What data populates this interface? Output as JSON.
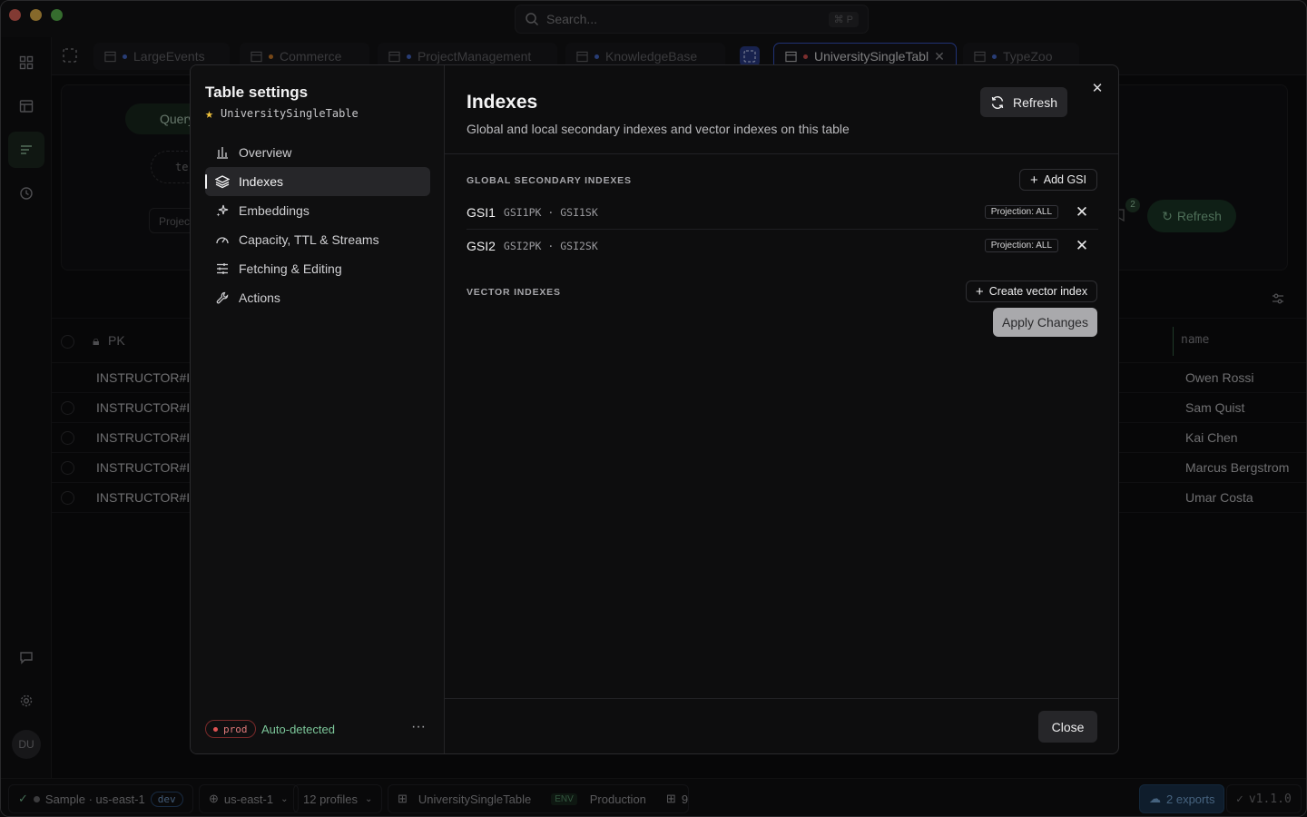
{
  "titlebar": {
    "search_placeholder": "Search...",
    "search_shortcut": "⌘ P"
  },
  "tabs": [
    {
      "label": "LargeEvents",
      "dot": "#4a6fd6"
    },
    {
      "label": "Commerce",
      "dot": "#d9822b"
    },
    {
      "label": "ProjectManagement",
      "dot": "#4a6fd6"
    },
    {
      "label": "KnowledgeBase",
      "dot": "#4a6fd6"
    },
    {
      "label": "UniversitySingleTabl",
      "dot": "#e05454"
    },
    {
      "label": "TypeZoo",
      "dot": "#4a6fd6"
    }
  ],
  "background": {
    "query_label": "Query",
    "filter_text": "te",
    "project_text": "Project",
    "badge_count": "2",
    "refresh_label": "Refresh",
    "pk_header": "PK",
    "name_header": "name",
    "rows": [
      {
        "pk": "INSTRUCTOR#IC",
        "name": "Owen Rossi"
      },
      {
        "pk": "INSTRUCTOR#IC",
        "name": "Sam Quist"
      },
      {
        "pk": "INSTRUCTOR#IC",
        "name": "Kai Chen"
      },
      {
        "pk": "INSTRUCTOR#IC",
        "name": "Marcus Bergstrom"
      },
      {
        "pk": "INSTRUCTOR#IC",
        "name": "Umar Costa"
      }
    ]
  },
  "rail": {
    "avatar_initials": "DU"
  },
  "modal": {
    "side": {
      "title": "Table settings",
      "table_name": "UniversitySingleTable",
      "nav": [
        {
          "label": "Overview",
          "icon": "bar-chart-icon"
        },
        {
          "label": "Indexes",
          "icon": "layers-icon"
        },
        {
          "label": "Embeddings",
          "icon": "sparkle-icon"
        },
        {
          "label": "Capacity, TTL & Streams",
          "icon": "gauge-icon"
        },
        {
          "label": "Fetching & Editing",
          "icon": "sliders-icon"
        },
        {
          "label": "Actions",
          "icon": "wrench-icon"
        }
      ],
      "env_badge": "prod",
      "auto_detected": "Auto-detected",
      "more": "···"
    },
    "main": {
      "title": "Indexes",
      "subtitle": "Global and local secondary indexes and vector indexes on this table",
      "refresh_label": "Refresh",
      "gsi_section_title": "GLOBAL SECONDARY INDEXES",
      "add_gsi_label": "Add GSI",
      "gsis": [
        {
          "name": "GSI1",
          "keys": "GSI1PK · GSI1SK",
          "projection": "Projection: ALL"
        },
        {
          "name": "GSI2",
          "keys": "GSI2PK · GSI2SK",
          "projection": "Projection: ALL"
        }
      ],
      "vector_section_title": "VECTOR INDEXES",
      "create_vector_label": "Create vector index",
      "apply_label": "Apply Changes",
      "close_label": "Close"
    }
  },
  "statusbar": {
    "connection": "Sample · us-east-1",
    "connection_env": "dev",
    "region": "us-east-1",
    "profiles": "12 profiles",
    "table": "UniversitySingleTable",
    "env_tag": "ENV",
    "env_name": "Production",
    "table_count": "9",
    "exports": "2 exports",
    "version": "v1.1.0"
  },
  "colors": {
    "accent_green": "#7cc79a",
    "accent_blue": "#3b5bd6",
    "danger": "#e05454"
  }
}
